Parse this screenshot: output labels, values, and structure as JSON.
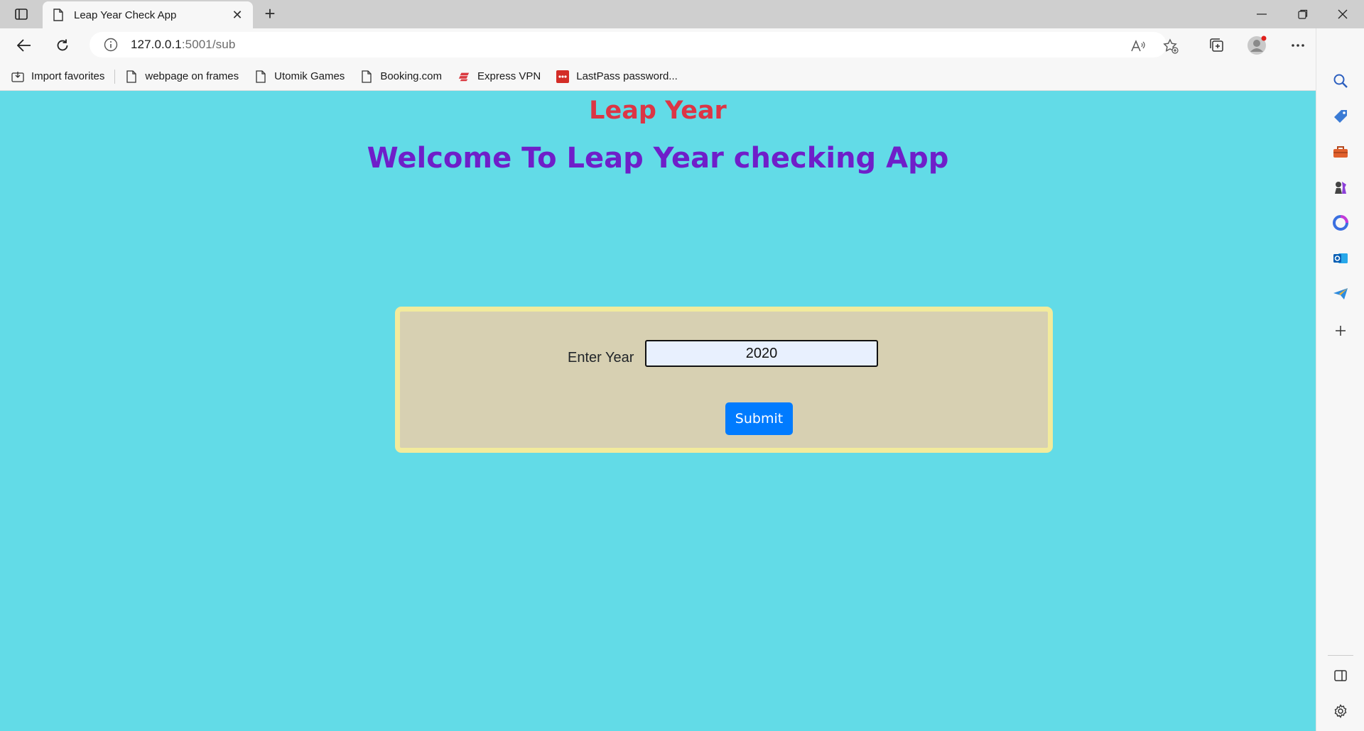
{
  "browser": {
    "tab": {
      "title": "Leap Year Check App",
      "close": "✕"
    },
    "new_tab": "+",
    "window": {
      "minimize": "—",
      "restore": "❐",
      "close": "✕"
    },
    "address": {
      "host": "127.0.0.1",
      "path": ":5001/sub"
    },
    "favorites": [
      {
        "label": "Import favorites",
        "icon": "import-icon"
      },
      {
        "label": "webpage on frames",
        "icon": "page-icon"
      },
      {
        "label": "Utomik Games",
        "icon": "page-icon"
      },
      {
        "label": "Booking.com",
        "icon": "page-icon"
      },
      {
        "label": "Express VPN",
        "icon": "expressvpn-icon"
      },
      {
        "label": "LastPass password...",
        "icon": "lastpass-icon"
      }
    ]
  },
  "page": {
    "title": "Leap Year",
    "welcome": "Welcome To Leap Year checking App",
    "form": {
      "label": "Enter Year",
      "year_value": "2020",
      "submit_label": "Submit"
    }
  },
  "colors": {
    "page_bg": "#62dbe7",
    "title": "#dc3545",
    "welcome": "#6f1ec9",
    "form_bg": "#d7d0b2",
    "form_border": "#f2eb9c",
    "button": "#007bff"
  }
}
